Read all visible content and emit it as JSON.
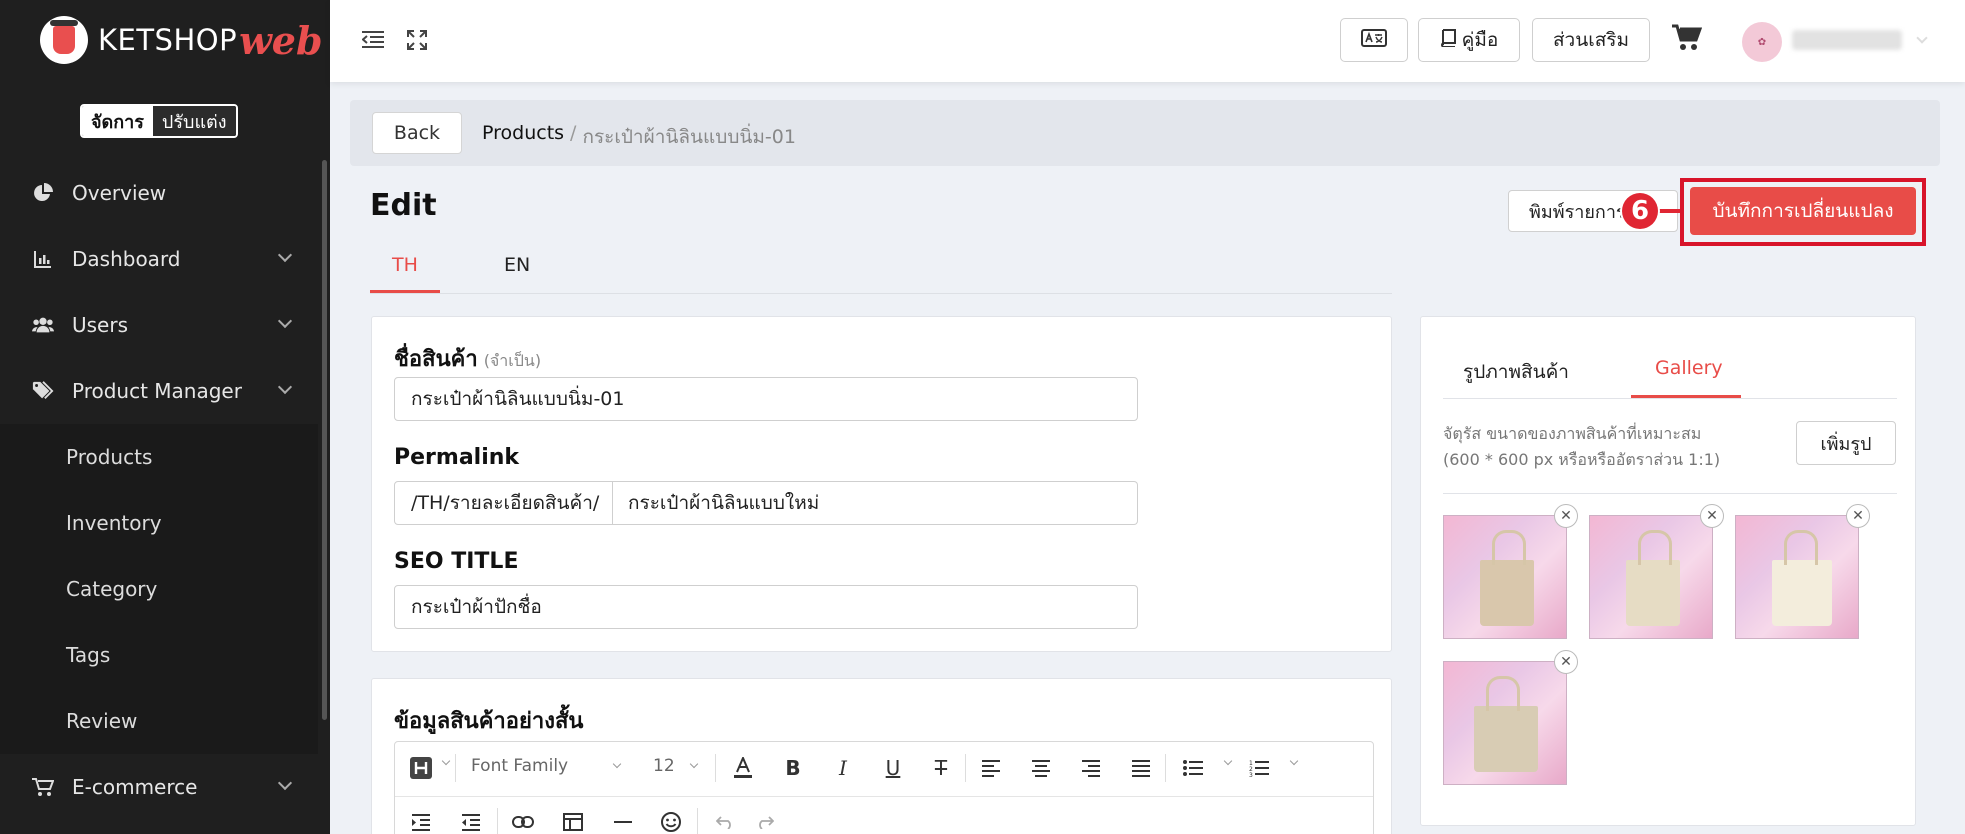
{
  "brand": {
    "name_part1": "KETSHOP",
    "name_part2": "web"
  },
  "mode_toggle": {
    "active": "จัดการ",
    "inactive": "ปรับแต่ง"
  },
  "sidebar": {
    "items": [
      {
        "label": "Overview",
        "icon": "pie-chart-icon"
      },
      {
        "label": "Dashboard",
        "icon": "bar-chart-icon"
      },
      {
        "label": "Users",
        "icon": "users-icon"
      },
      {
        "label": "Product Manager",
        "icon": "tags-icon"
      }
    ],
    "sub_items": [
      {
        "label": "Products"
      },
      {
        "label": "Inventory"
      },
      {
        "label": "Category"
      },
      {
        "label": "Tags"
      },
      {
        "label": "Review"
      }
    ],
    "ecommerce": {
      "label": "E-commerce",
      "icon": "cart-icon"
    }
  },
  "topbar": {
    "translate_icon": "translate-icon",
    "manual_label": "คู่มือ",
    "addons_label": "ส่วนเสริม",
    "cart_icon": "cart-icon"
  },
  "breadcrumb": {
    "back_label": "Back",
    "parent": "Products",
    "separator": "/",
    "current": "กระเป๋าผ้านิลินแบบนิ่ม-01"
  },
  "page": {
    "title": "Edit",
    "print_label": "พิมพ์รายการ",
    "callout_number": "6",
    "save_label": "บันทึกการเปลี่ยนแปลง"
  },
  "lang_tabs": [
    {
      "label": "TH"
    },
    {
      "label": "EN"
    }
  ],
  "form": {
    "name_label": "ชื่อสินค้า",
    "required_label": "(จำเป็น)",
    "name_value": "กระเป๋าผ้านิลินแบบนิ่ม-01",
    "permalink_label": "Permalink",
    "permalink_prefix": "/TH/รายละเอียดสินค้า/",
    "permalink_value": "กระเป๋าผ้านิลินแบบใหม่",
    "seo_label": "SEO TITLE",
    "seo_value": "กระเป๋าผ้าปักชื่อ"
  },
  "short_desc": {
    "label": "ข้อมูลสินค้าอย่างสั้น",
    "font_family_placeholder": "Font Family",
    "font_size": "12"
  },
  "gallery": {
    "tab_images": "รูปภาพสินค้า",
    "tab_gallery": "Gallery",
    "hint_line1": "จัตุรัส ขนาดของภาพสินค้าที่เหมาะสม",
    "hint_line2": "(600 * 600 px หรือหรืออัตราส่วน 1:1)",
    "add_label": "เพิ่มรูป",
    "close_glyph": "✕"
  },
  "colors": {
    "accent": "#e84c48",
    "sidebar_bg": "#1f1f1f",
    "highlight": "#d8142a"
  }
}
